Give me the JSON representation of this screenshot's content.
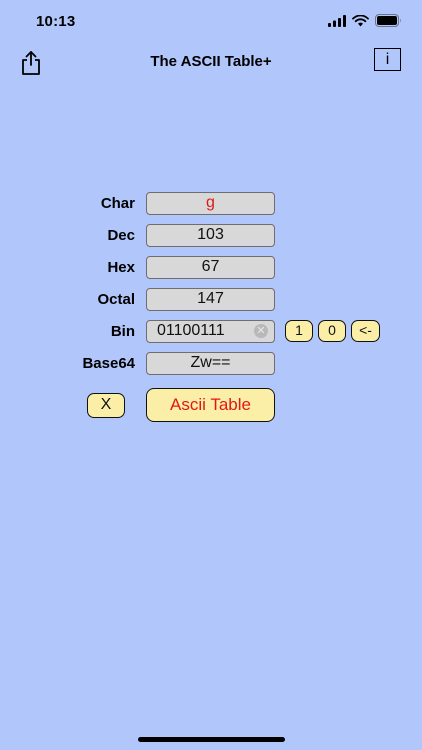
{
  "status": {
    "time": "10:13",
    "icons": [
      "signal-icon",
      "wifi-icon",
      "battery-icon"
    ]
  },
  "nav": {
    "title": "The ASCII Table+",
    "info_label": "i",
    "left_icon": "share-icon"
  },
  "rows": {
    "char": {
      "label": "Char",
      "value": "g"
    },
    "dec": {
      "label": "Dec",
      "value": "103"
    },
    "hex": {
      "label": "Hex",
      "value": "67"
    },
    "octal": {
      "label": "Octal",
      "value": "147"
    },
    "bin": {
      "label": "Bin",
      "value": "01100111"
    },
    "base64": {
      "label": "Base64",
      "value": "Zw=="
    }
  },
  "bin_buttons": {
    "one": "1",
    "zero": "0",
    "backspace": "<-"
  },
  "actions": {
    "clear_label": "X",
    "ascii_table_label": "Ascii Table"
  },
  "colors": {
    "background": "#b1c7fc",
    "field_bg": "#d8d8d8",
    "button_bg": "#fbefa8",
    "accent_red": "#e11717"
  }
}
